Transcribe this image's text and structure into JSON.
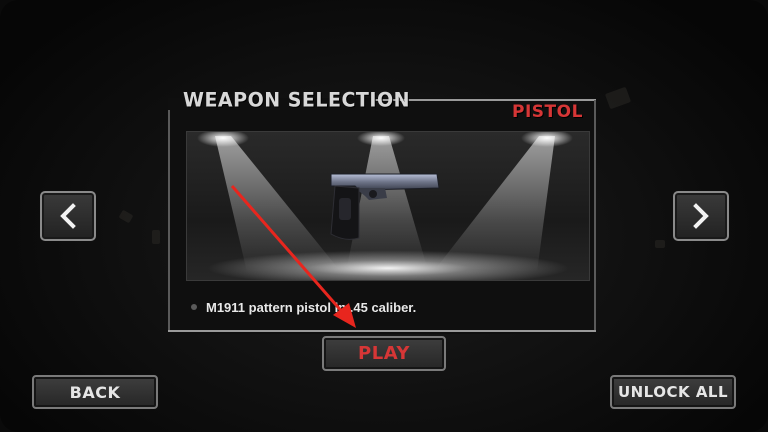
{
  "header": {
    "title": "WEAPON SELECTION",
    "weapon_type": "PISTOL"
  },
  "weapon": {
    "description": "M1911 pattern pistol in .45 caliber."
  },
  "buttons": {
    "play": "PLAY",
    "back": "BACK",
    "unlock_all": "UNLOCK ALL"
  },
  "icons": {
    "prev": "chevron-left-icon",
    "next": "chevron-right-icon"
  },
  "colors": {
    "accent_red": "#d63636",
    "annotation_arrow": "#e8261e"
  }
}
